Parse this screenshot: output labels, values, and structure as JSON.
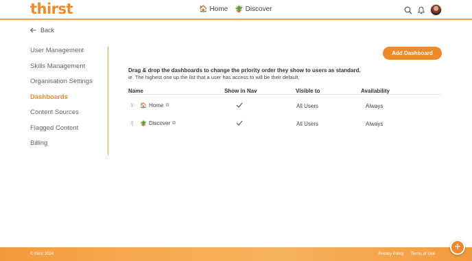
{
  "brand": {
    "logo": "thirst",
    "accent": "#ee8a2c"
  },
  "nav": [
    {
      "emoji": "🏠",
      "label": "Home"
    },
    {
      "emoji": "🪴",
      "label": "Discover"
    }
  ],
  "header_icons": [
    "search-icon",
    "bell-icon",
    "avatar"
  ],
  "back_label": "Back",
  "sidebar": {
    "items": [
      {
        "label": "User Management"
      },
      {
        "label": "Skills Management"
      },
      {
        "label": "Organisation Settings"
      },
      {
        "label": "Dashboards",
        "active": true
      },
      {
        "label": "Content Sources"
      },
      {
        "label": "Flagged Content"
      },
      {
        "label": "Billing"
      }
    ]
  },
  "main": {
    "add_button": "Add Dashboard",
    "description": "Drag & drop the dashboards to change the priority order they show to users as standard.",
    "description_2": "ie. The highest one up the list that a user has access to will be their default.",
    "columns": [
      "Name",
      "Show in Nav",
      "Visible to",
      "Availability"
    ],
    "rows": [
      {
        "emoji": "🏠",
        "name": "Home",
        "show_in_nav": true,
        "visible_to": "All Users",
        "availability": "Always"
      },
      {
        "emoji": "🪴",
        "name": "Discover",
        "show_in_nav": true,
        "visible_to": "All Users",
        "availability": "Always"
      }
    ]
  },
  "footer": {
    "copyright": "© thirst 2024",
    "links": [
      "Privacy Policy",
      "Terms of Use"
    ]
  }
}
